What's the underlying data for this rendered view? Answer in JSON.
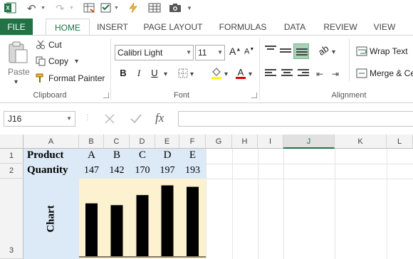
{
  "colors": {
    "excel_green": "#217346",
    "header_blue": "#dce9f6",
    "chart_cream": "#fdf2d0"
  },
  "ribbon": {
    "tabs": [
      "FILE",
      "HOME",
      "INSERT",
      "PAGE LAYOUT",
      "FORMULAS",
      "DATA",
      "REVIEW",
      "VIEW"
    ],
    "clipboard": {
      "paste": "Paste",
      "cut": "Cut",
      "copy": "Copy",
      "format_painter": "Format Painter",
      "label": "Clipboard"
    },
    "font": {
      "name": "Calibri Light",
      "size": "11",
      "bold": "B",
      "italic": "I",
      "underline": "U",
      "label": "Font"
    },
    "alignment": {
      "wrap_text": "Wrap Text",
      "merge": "Merge & Ce",
      "label": "Alignment"
    }
  },
  "formula_bar": {
    "name_box": "J16",
    "fx": "fx",
    "formula": ""
  },
  "grid": {
    "columns": [
      "A",
      "B",
      "C",
      "D",
      "E",
      "F",
      "G",
      "H",
      "I",
      "J",
      "K",
      "L"
    ],
    "rows": [
      "1",
      "2",
      "3"
    ],
    "row1": {
      "label": "Product",
      "values": [
        "A",
        "B",
        "C",
        "D",
        "E"
      ]
    },
    "row2": {
      "label": "Quantity",
      "values": [
        "147",
        "142",
        "170",
        "197",
        "193"
      ]
    },
    "chart_label": "Chart"
  },
  "chart_data": {
    "type": "bar",
    "categories": [
      "A",
      "B",
      "C",
      "D",
      "E"
    ],
    "values": [
      147,
      142,
      170,
      197,
      193
    ],
    "title": "Chart",
    "xlabel": "",
    "ylabel": "",
    "ylim": [
      0,
      200
    ]
  }
}
